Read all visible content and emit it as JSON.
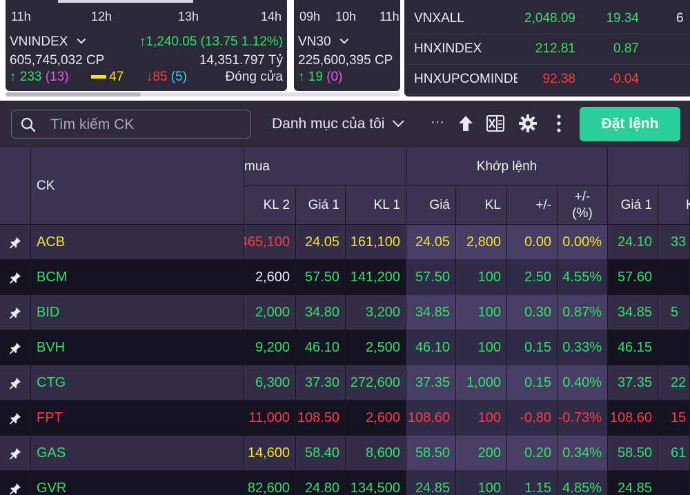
{
  "top": {
    "card1": {
      "ticks": [
        "11h",
        "12h",
        "13h",
        "14h"
      ],
      "index_name": "VNINDEX",
      "index_value": "↑1,240.05 (13.75 1.12%)",
      "volume": "605,745,032 CP",
      "value": "14,351.797 Tỷ",
      "up": "↑ 233",
      "up_ceiling": "(13)",
      "flat": "47",
      "down": "↓85",
      "down_floor": "(5)",
      "status": "Đóng cửa"
    },
    "card2": {
      "ticks": [
        "09h",
        "10h",
        "11h"
      ],
      "index_name": "VN30",
      "volume": "225,600,395 CP",
      "up": "↑ 19",
      "up_ceiling": "(0)"
    },
    "indices": [
      {
        "name": "VNXALL",
        "value": "2,048.09",
        "change": "19.34",
        "extra": "6",
        "color": "#35e06a"
      },
      {
        "name": "HNXINDEX",
        "value": "212.81",
        "change": "0.87",
        "extra": "",
        "color": "#35e06a"
      },
      {
        "name": "HNXUPCOMINDE",
        "value": "92.38",
        "change": "-0.04",
        "extra": "",
        "color": "#ff3a48"
      }
    ]
  },
  "toolbar": {
    "search_placeholder": "Tìm kiếm CK",
    "watchlist": "Danh mục của tôi",
    "more": "···",
    "order_button": "Đặt lệnh",
    "accent": "#2bcf9a"
  },
  "table": {
    "header_top": {
      "ck": "CK",
      "buy": "mua",
      "match": "Khớp lệnh"
    },
    "headers": [
      "KL 2",
      "Giá 1",
      "KL 1",
      "Giá",
      "KL",
      "+/-",
      "+/-\n(%)",
      "Giá 1",
      "K"
    ],
    "rows": [
      {
        "sym": "ACB",
        "color": "#f5e32a",
        "kl2": "465,100",
        "kl2c": "#ff3a48",
        "g1": "24.05",
        "g1c": "#f5e32a",
        "kl1": "161,100",
        "kl1c": "#f5e32a",
        "gia": "24.05",
        "kl": "2,800",
        "chg": "0.00",
        "pct": "0.00%",
        "mc": "#f5e32a",
        "sg1": "24.10",
        "sg1c": "#35e06a",
        "sk": "33"
      },
      {
        "sym": "BCM",
        "color": "#35e06a",
        "kl2": "2,600",
        "kl2c": "#f0eef5",
        "g1": "57.50",
        "g1c": "#35e06a",
        "kl1": "141,200",
        "kl1c": "#35e06a",
        "gia": "57.50",
        "kl": "100",
        "chg": "2.50",
        "pct": "4.55%",
        "mc": "#35e06a",
        "sg1": "57.60",
        "sg1c": "#35e06a",
        "sk": ""
      },
      {
        "sym": "BID",
        "color": "#35e06a",
        "kl2": "2,000",
        "kl2c": "#35e06a",
        "g1": "34.80",
        "g1c": "#35e06a",
        "kl1": "3,200",
        "kl1c": "#35e06a",
        "gia": "34.85",
        "kl": "100",
        "chg": "0.30",
        "pct": "0.87%",
        "mc": "#35e06a",
        "sg1": "34.85",
        "sg1c": "#35e06a",
        "sk": "5"
      },
      {
        "sym": "BVH",
        "color": "#35e06a",
        "kl2": "9,200",
        "kl2c": "#35e06a",
        "g1": "46.10",
        "g1c": "#35e06a",
        "kl1": "2,500",
        "kl1c": "#35e06a",
        "gia": "46.10",
        "kl": "100",
        "chg": "0.15",
        "pct": "0.33%",
        "mc": "#35e06a",
        "sg1": "46.15",
        "sg1c": "#35e06a",
        "sk": ""
      },
      {
        "sym": "CTG",
        "color": "#35e06a",
        "kl2": "6,300",
        "kl2c": "#35e06a",
        "g1": "37.30",
        "g1c": "#35e06a",
        "kl1": "272,600",
        "kl1c": "#35e06a",
        "gia": "37.35",
        "kl": "1,000",
        "chg": "0.15",
        "pct": "0.40%",
        "mc": "#35e06a",
        "sg1": "37.35",
        "sg1c": "#35e06a",
        "sk": "22"
      },
      {
        "sym": "FPT",
        "color": "#ff3a48",
        "kl2": "11,000",
        "kl2c": "#ff3a48",
        "g1": "108.50",
        "g1c": "#ff3a48",
        "kl1": "2,600",
        "kl1c": "#ff3a48",
        "gia": "108.60",
        "kl": "100",
        "chg": "-0.80",
        "pct": "-0.73%",
        "mc": "#ff3a48",
        "sg1": "108.60",
        "sg1c": "#ff3a48",
        "sk": "15"
      },
      {
        "sym": "GAS",
        "color": "#35e06a",
        "kl2": "14,600",
        "kl2c": "#f5e32a",
        "g1": "58.40",
        "g1c": "#35e06a",
        "kl1": "8,600",
        "kl1c": "#35e06a",
        "gia": "58.50",
        "kl": "200",
        "chg": "0.20",
        "pct": "0.34%",
        "mc": "#35e06a",
        "sg1": "58.50",
        "sg1c": "#35e06a",
        "sk": "61"
      },
      {
        "sym": "GVR",
        "color": "#35e06a",
        "kl2": "82,600",
        "kl2c": "#35e06a",
        "g1": "24.80",
        "g1c": "#35e06a",
        "kl1": "134,500",
        "kl1c": "#35e06a",
        "gia": "24.85",
        "kl": "100",
        "chg": "1.15",
        "pct": "4.85%",
        "mc": "#35e06a",
        "sg1": "24.85",
        "sg1c": "#35e06a",
        "sk": ""
      }
    ]
  }
}
